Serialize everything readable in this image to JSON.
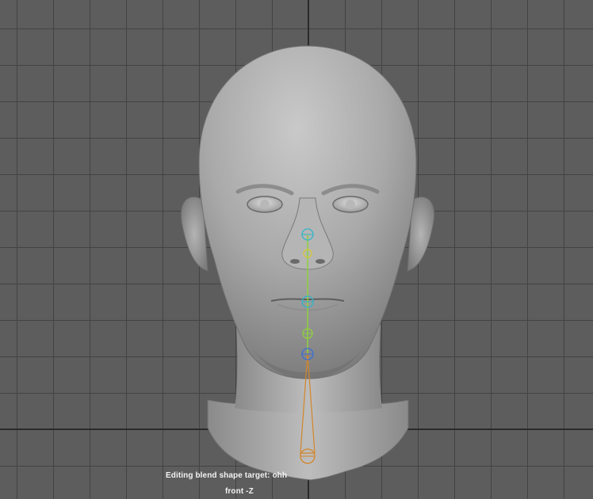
{
  "viewport": {
    "status_text": "Editing blend shape target: ohh",
    "camera_label": "front -Z"
  },
  "icons": {
    "joint_marker": "joint-circle-icon",
    "bone": "bone-icon"
  },
  "colors": {
    "background": "#5d5d5d",
    "grid_line": "#434343",
    "axis_line": "#2b2b2b",
    "joint_cyan": "#2fb6c8",
    "joint_green": "#8fd13d",
    "joint_yellow": "#d8c93a",
    "joint_blue": "#3a6fd8",
    "joint_orange": "#d3862a",
    "hud_text": "#f2f2f2"
  }
}
